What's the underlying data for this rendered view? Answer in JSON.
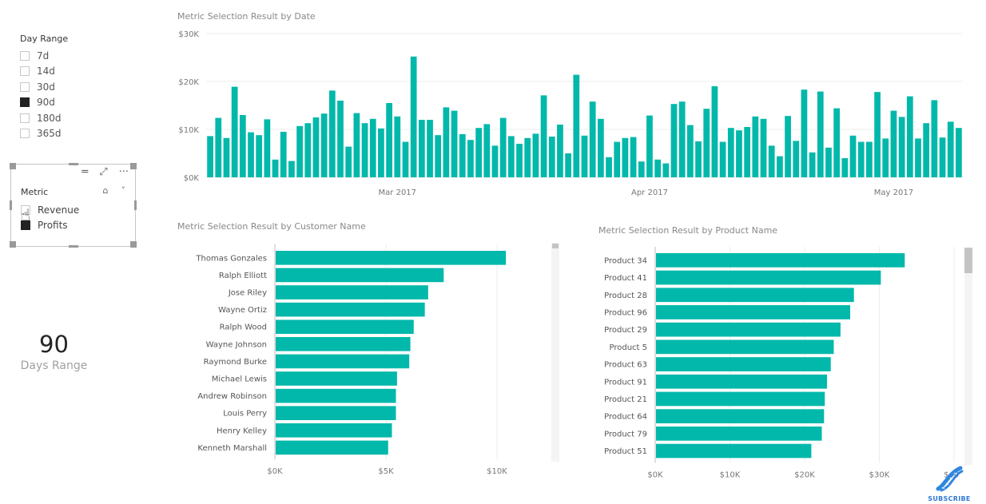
{
  "day_range_slicer": {
    "title": "Day Range",
    "items": [
      {
        "label": "7d",
        "checked": false
      },
      {
        "label": "14d",
        "checked": false
      },
      {
        "label": "30d",
        "checked": false
      },
      {
        "label": "90d",
        "checked": true
      },
      {
        "label": "180d",
        "checked": false
      },
      {
        "label": "365d",
        "checked": false
      }
    ]
  },
  "metric_slicer": {
    "title": "Metric",
    "header_icons": [
      "drag-handle-icon",
      "focus-mode-icon",
      "more-options-icon"
    ],
    "tool_icons": [
      "eraser-icon",
      "chevron-down-icon"
    ],
    "glyphs": {
      "drag": "═",
      "focus": "⤢",
      "more": "···",
      "eraser": "⌂",
      "chevron": "˅",
      "cursor": "☝"
    },
    "items": [
      {
        "label": "Revenue",
        "checked": false
      },
      {
        "label": "Profits",
        "checked": true
      }
    ]
  },
  "kpi_card": {
    "value": "90",
    "label": "Days Range"
  },
  "watermark": {
    "label": "SUBSCRIBE",
    "icon": "dna-icon"
  },
  "colors": {
    "bar": "#01B8AA",
    "grid": "#eeeeee",
    "axis_text": "#777777",
    "category_text": "#555555"
  },
  "chart_data": [
    {
      "id": "by-date",
      "type": "bar",
      "title": "Metric Selection Result by Date",
      "xlabel": "",
      "ylabel": "",
      "ylim": [
        0,
        30000
      ],
      "yticks": [
        0,
        10000,
        20000,
        30000
      ],
      "ytick_labels": [
        "$0K",
        "$10K",
        "$20K",
        "$30K"
      ],
      "xtick_labels": [
        {
          "label": "Mar 2017",
          "bar_index": 23
        },
        {
          "label": "Apr 2017",
          "bar_index": 54
        },
        {
          "label": "May 2017",
          "bar_index": 84
        }
      ],
      "grid": true,
      "legend": "none",
      "values": [
        8600,
        12400,
        8200,
        18900,
        13000,
        9400,
        8800,
        12100,
        3700,
        9500,
        3400,
        10700,
        11300,
        12500,
        13300,
        18100,
        16000,
        6400,
        13400,
        11300,
        12200,
        10200,
        15500,
        12700,
        7400,
        25200,
        12000,
        12000,
        8800,
        14600,
        13900,
        9000,
        7800,
        10300,
        11100,
        6600,
        12400,
        8600,
        7000,
        8200,
        9100,
        17100,
        8500,
        11000,
        5000,
        21400,
        8700,
        15800,
        12200,
        4200,
        7400,
        8200,
        8400,
        3300,
        12900,
        3700,
        2900,
        15300,
        15800,
        10900,
        7500,
        14300,
        19000,
        7400,
        10300,
        9800,
        10500,
        12700,
        12200,
        6600,
        4400,
        12800,
        7600,
        18300,
        5200,
        17900,
        6200,
        14400,
        4000,
        8700,
        7400,
        7400,
        17800,
        8100,
        13900,
        12600,
        16900,
        8100,
        11300,
        16100,
        8300,
        11600,
        10300
      ]
    },
    {
      "id": "by-customer",
      "type": "bar",
      "orientation": "horizontal",
      "title": "Metric Selection Result by Customer Name",
      "xlim": [
        0,
        12000
      ],
      "xticks": [
        0,
        5000,
        10000
      ],
      "xtick_labels": [
        "$0K",
        "$5K",
        "$10K"
      ],
      "grid": true,
      "legend": "none",
      "categories": [
        "Thomas Gonzales",
        "Ralph Elliott",
        "Jose Riley",
        "Wayne Ortiz",
        "Ralph Wood",
        "Wayne Johnson",
        "Raymond Burke",
        "Michael Lewis",
        "Andrew Robinson",
        "Louis Perry",
        "Henry Kelley",
        "Kenneth Marshall"
      ],
      "values": [
        10400,
        7600,
        6900,
        6750,
        6250,
        6100,
        6050,
        5500,
        5450,
        5450,
        5270,
        5100
      ]
    },
    {
      "id": "by-product",
      "type": "bar",
      "orientation": "horizontal",
      "title": "Metric Selection Result by Product Name",
      "xlim": [
        0,
        40000
      ],
      "xticks": [
        0,
        10000,
        20000,
        30000,
        40000
      ],
      "xtick_labels": [
        "$0K",
        "$10K",
        "$20K",
        "$30K",
        "$40K"
      ],
      "grid": true,
      "legend": "none",
      "categories": [
        "Product 34",
        "Product 41",
        "Product 28",
        "Product 96",
        "Product 29",
        "Product 5",
        "Product 63",
        "Product 91",
        "Product 21",
        "Product 64",
        "Product 79",
        "Product 51"
      ],
      "values": [
        33400,
        30200,
        26600,
        26100,
        24800,
        23900,
        23500,
        23000,
        22700,
        22600,
        22300,
        20900
      ]
    }
  ]
}
